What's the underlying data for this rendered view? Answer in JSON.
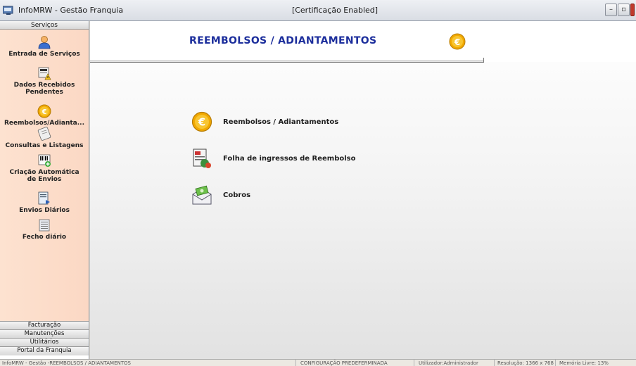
{
  "window": {
    "app_title": "InfoMRW - Gestão Franquia",
    "center_title": "[Certificação Enabled]",
    "minimize_glyph": "–",
    "maximize_glyph": "▫"
  },
  "sidebar": {
    "header": "Serviços",
    "items": [
      {
        "label": "Entrada de Serviços",
        "icon": "person-icon"
      },
      {
        "label": "Dados Recebidos Pendentes",
        "icon": "warning-document-icon"
      },
      {
        "label": "Reembolsos/Adianta...",
        "icon": "euro-coin-icon"
      },
      {
        "label": "Consultas e Listagens",
        "icon": "scroll-icon"
      },
      {
        "label": "Criação Automática de Envios",
        "icon": "barcode-add-icon"
      },
      {
        "label": "Envios Diários",
        "icon": "document-arrow-icon"
      },
      {
        "label": "Fecho diário",
        "icon": "ledger-icon"
      }
    ],
    "bottom_sections": [
      "Facturação",
      "Manutenções",
      "Utilitários",
      "Portal da Franquia"
    ]
  },
  "main": {
    "title": "REEMBOLSOS / ADIANTAMENTOS",
    "menu": [
      {
        "label": "Reembolsos / Adiantamentos",
        "icon": "euro-coin-icon"
      },
      {
        "label": "Folha de ingressos de Reembolso",
        "icon": "refund-sheet-icon"
      },
      {
        "label": "Cobros",
        "icon": "money-envelope-icon"
      }
    ]
  },
  "statusbar": {
    "path": "InfoMRW - Gestão -REEMBOLSOS / ADIANTAMENTOS",
    "config": "CONFIGURAÇÃO PREDEFERMINADA",
    "user": "Utilizador:Administrador",
    "resolution": "Resolução: 1366 x 768",
    "memory": "Memória Livre: 13%"
  },
  "colors": {
    "title_blue": "#1c2e9c",
    "coin_gold": "#f2a900",
    "sidebar_bg": "#fde2d0"
  }
}
